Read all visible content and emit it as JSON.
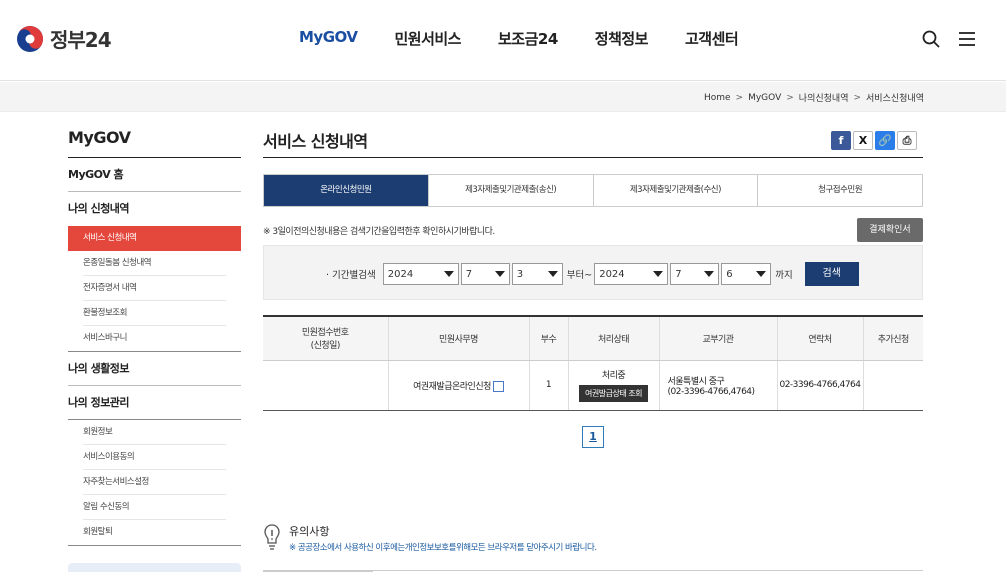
{
  "header": {
    "logo_text": "정부24",
    "nav": [
      "MyGOV",
      "민원서비스",
      "보조금24",
      "정책정보",
      "고객센터"
    ],
    "colors": {
      "accent": "#1a4ea2",
      "active_menu": "#e4473c",
      "navy": "#1c3d72"
    }
  },
  "breadcrumb": [
    "Home",
    "MyGOV",
    "나의신청내역",
    "서비스신청내역"
  ],
  "lnb": {
    "title": "MyGOV",
    "home": "MyGOV 홈",
    "sec1": "나의 신청내역",
    "sec1_items": [
      "서비스 신청내역",
      "온종일돌봄 신청내역",
      "전자증명서 내역",
      "환불정보조회",
      "서비스바구니"
    ],
    "sec2": "나의 생활정보",
    "sec3": "나의 정보관리",
    "sec3_items": [
      "회원정보",
      "서비스이용동의",
      "자주찾는서비스설정",
      "알림 수신동의",
      "회원탈퇴"
    ]
  },
  "main": {
    "title": "서비스 신청내역",
    "share": {
      "facebook": "f",
      "x": "X",
      "link": "🔗",
      "print": "⎙"
    },
    "tabs": [
      "온라인신청민원",
      "제3자제출및기관제출(송신)",
      "제3자제출및기관제출(수신)",
      "청구접수민원"
    ],
    "notice": "※ 3일이전의신청내용은 검색기간을입력한후 확인하시기바랍니다.",
    "receipt_button": "결제확인서",
    "search": {
      "label": "· 기간별검색",
      "from_year": "2024",
      "from_month": "7",
      "from_day": "3",
      "from_suffix": "부터~",
      "to_year": "2024",
      "to_month": "7",
      "to_day": "6",
      "to_suffix": "까지",
      "button": "검색"
    },
    "table": {
      "headers": [
        "민원접수번호\n(신청일)",
        "민원사무명",
        "부수",
        "처리상태",
        "교부기관",
        "연락처",
        "추가신청"
      ],
      "rows": [
        {
          "receipt_no": "",
          "name": "여권재발급온라인신청",
          "copies": "1",
          "status": "처리중",
          "status_button": "여권발급상태 조회",
          "agency_line1": "서울특별시 중구",
          "agency_line2": "(02-3396-4766,4764)",
          "contact": "02-3396-4766,4764",
          "extra": ""
        }
      ]
    },
    "page": "1",
    "caution": {
      "title": "유의사항",
      "desc": "※ 공공장소에서 사용하신 이후에는개인정보보호를위해모든 브라우저를 닫아주시기 바랍니다."
    }
  }
}
